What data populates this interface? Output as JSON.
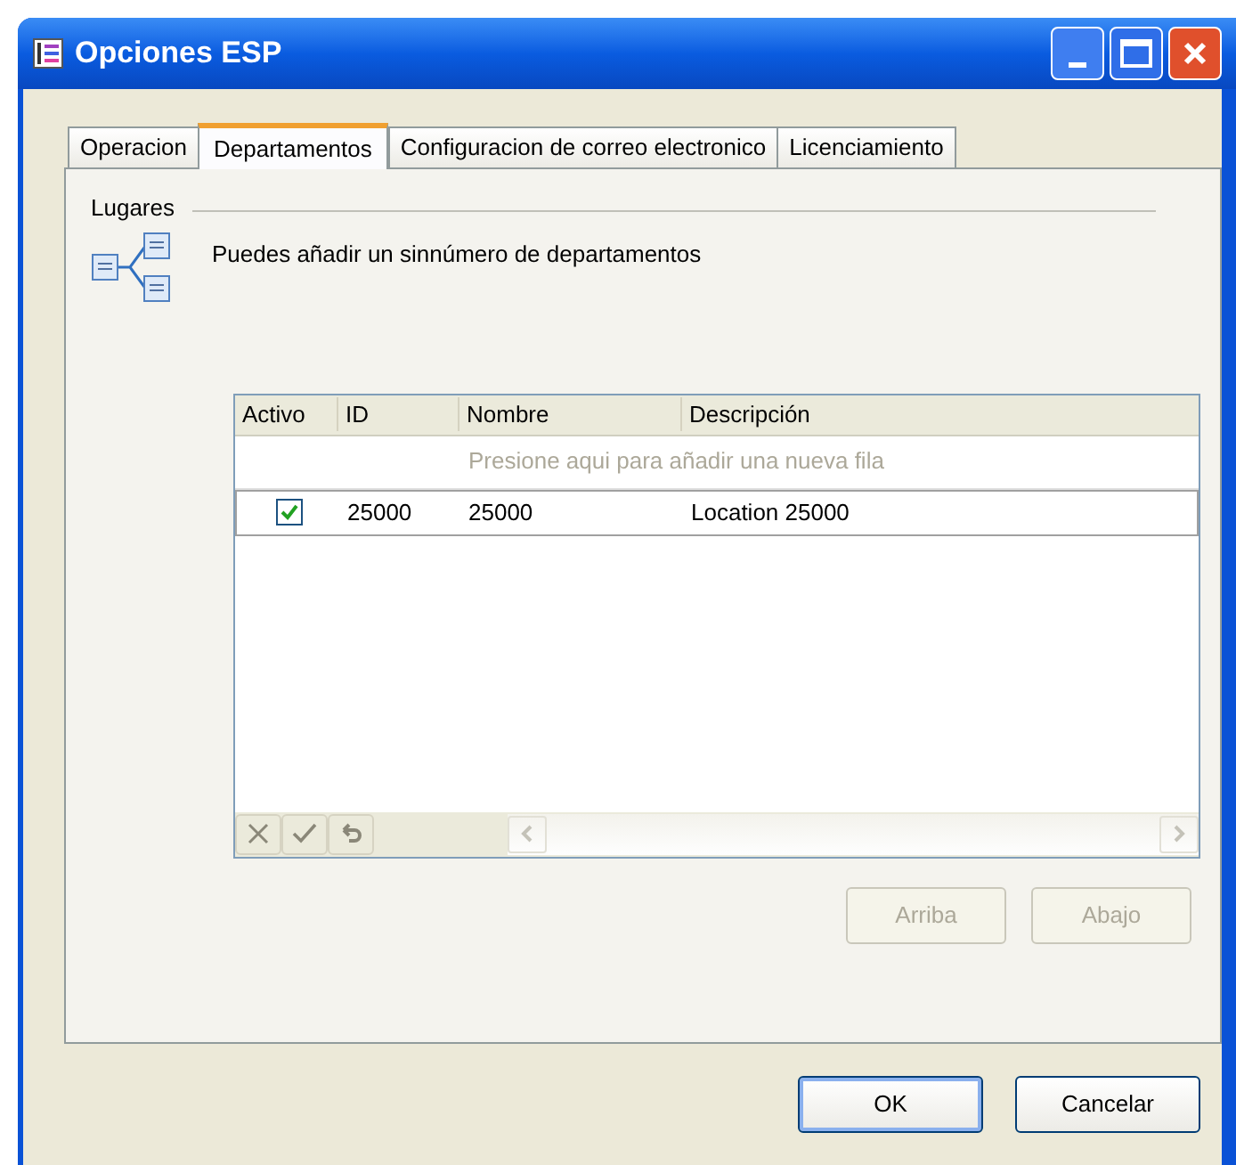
{
  "window": {
    "title": "Opciones ESP"
  },
  "tabs": [
    {
      "label": "Operacion",
      "selected": false
    },
    {
      "label": "Departamentos",
      "selected": true
    },
    {
      "label": "Configuracion de correo electronico",
      "selected": false
    },
    {
      "label": "Licenciamiento",
      "selected": false
    }
  ],
  "section": {
    "title": "Lugares",
    "description": "Puedes añadir un sinnúmero de departamentos"
  },
  "table": {
    "columns": [
      "Activo",
      "ID",
      "Nombre",
      "Descripción"
    ],
    "new_row_hint": "Presione aqui para añadir una nueva fila",
    "rows": [
      {
        "checked": true,
        "selected": true,
        "id": "25000",
        "nombre": "25000",
        "descripcion": "Location 25000"
      }
    ]
  },
  "move_buttons": [
    {
      "label": "Arriba",
      "disabled": true
    },
    {
      "label": "Abajo",
      "disabled": true
    }
  ],
  "buttons": [
    {
      "label": "OK",
      "default": true
    },
    {
      "label": "Cancelar",
      "default": false
    }
  ]
}
